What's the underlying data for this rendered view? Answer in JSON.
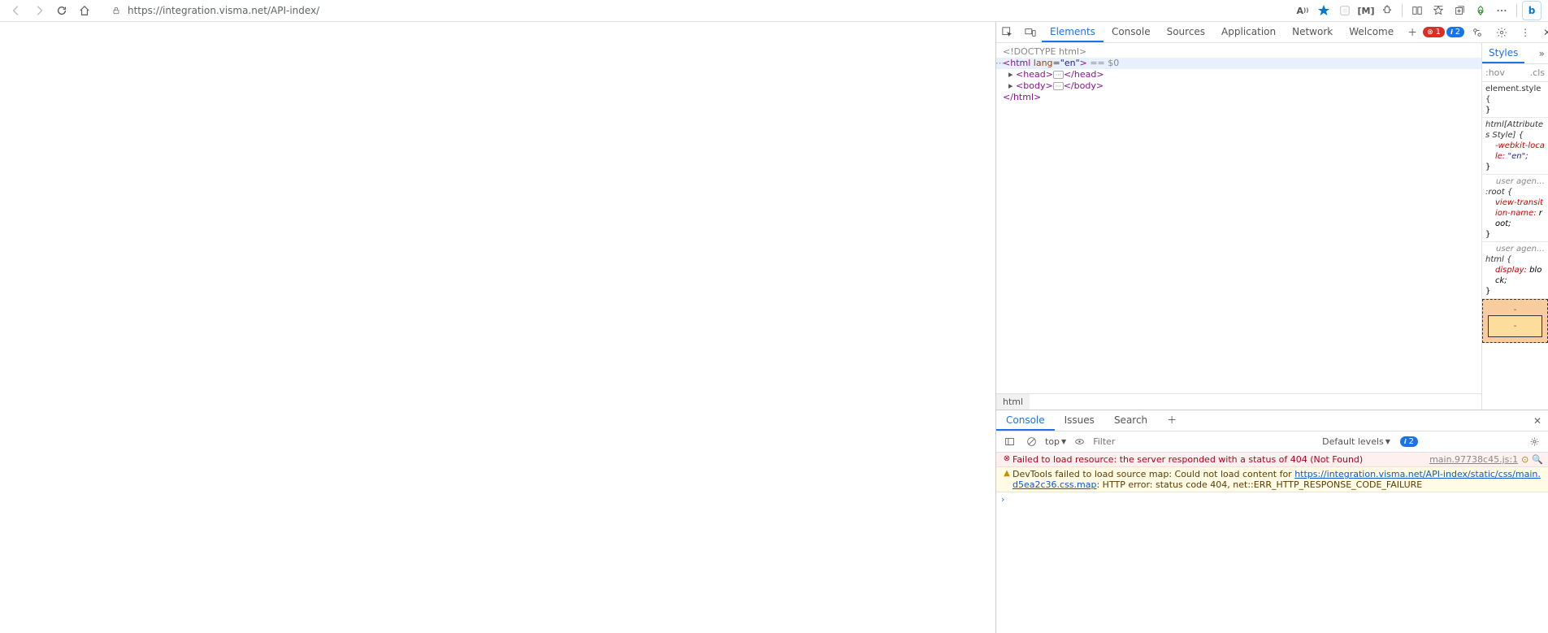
{
  "url": "https://integration.visma.net/API-index/",
  "devtools": {
    "tabs": [
      "Elements",
      "Console",
      "Sources",
      "Application",
      "Network",
      "Welcome"
    ],
    "activeTab": "Elements",
    "errorCount": "1",
    "infoCount": "2",
    "dom": {
      "doctype": "<!DOCTYPE html>",
      "htmlOpen": "<",
      "htmlTag": "html",
      "htmlAttrName": "lang",
      "htmlAttrVal": "\"en\"",
      "htmlClose": ">",
      "eqS0": " == $0",
      "headOpen": "<",
      "headTag": "head",
      "headMid": ">",
      "headCloseOpen": "</",
      "headCloseTag": "head",
      "headCloseMid": ">",
      "bodyOpen": "<",
      "bodyTag": "body",
      "bodyMid": ">",
      "bodyCloseOpen": "</",
      "bodyCloseTag": "body",
      "bodyCloseMid": ">",
      "htmlEndOpen": "</",
      "htmlEndTag": "html",
      "htmlEndMid": ">"
    },
    "crumb": "html",
    "styles": {
      "tab": "Styles",
      "hov": ":hov",
      "cls": ".cls",
      "elementStyleSel": "element.style {",
      "elementStyleClose": "}",
      "htmlAttrSel": "html[Attributes Style] {",
      "htmlAttrProp": "-webkit-locale:",
      "htmlAttrVal": "\"en\";",
      "htmlAttrClose": "}",
      "ua1Label": "user agen…",
      "rootSel": ":root {",
      "rootProp": "view-transition-name:",
      "rootVal": "root;",
      "rootClose": "}",
      "ua2Label": "user agen…",
      "htmlSel": "html {",
      "htmlProp": "display:",
      "htmlVal": "block;",
      "htmlClose": "}",
      "bmDash": "-"
    },
    "consoleDrawer": {
      "tabs": [
        "Console",
        "Issues",
        "Search"
      ],
      "activeTab": "Console",
      "top": "top",
      "filter": "Filter",
      "levels": "Default levels",
      "infoCount": "2",
      "errMsg": "Failed to load resource: the server responded with a status of 404 (Not Found)",
      "errSrc": "main.97738c45.js:1",
      "warnPrefix": "DevTools failed to load source map: Could not load content for ",
      "warnLink": "https://integration.visma.net/API-index/static/css/main.d5ea2c36.css.map",
      "warnSuffix": ": HTTP error: status code 404, net::ERR_HTTP_RESPONSE_CODE_FAILURE"
    }
  }
}
